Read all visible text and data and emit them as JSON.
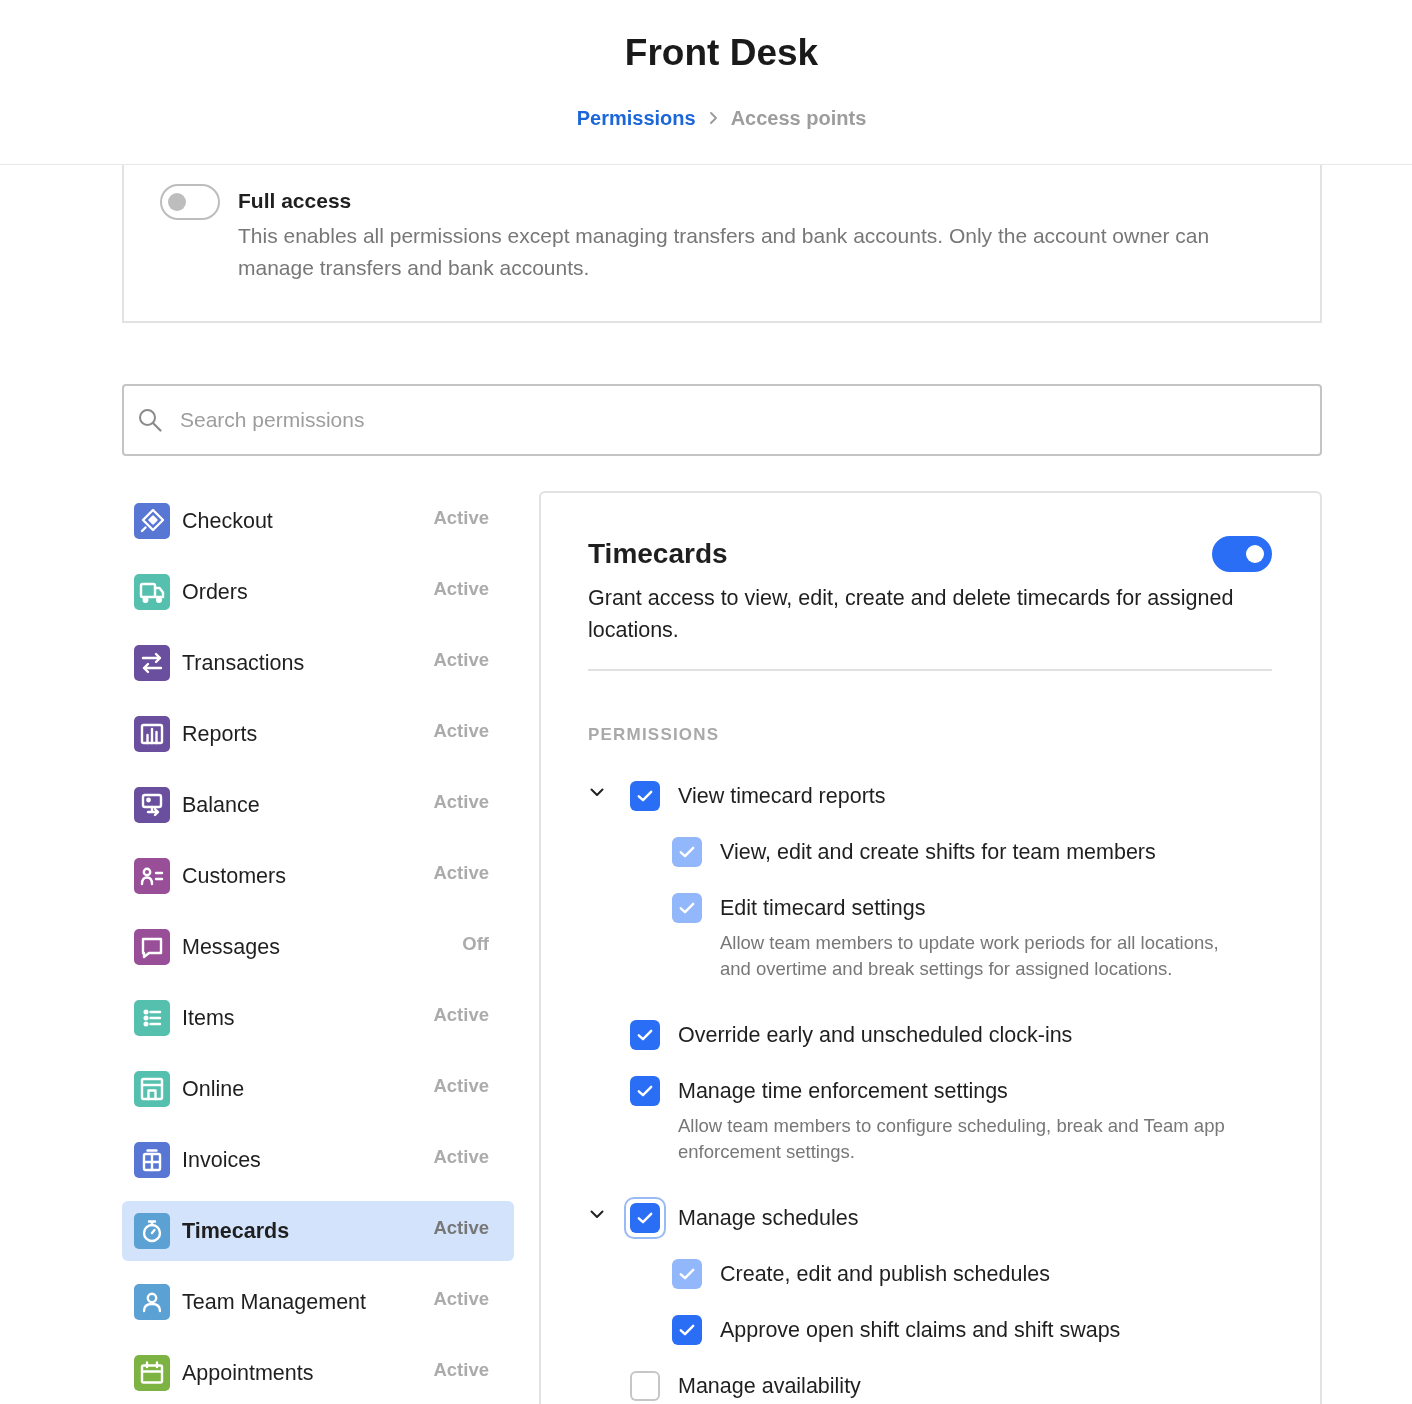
{
  "header": {
    "title": "Front Desk",
    "breadcrumb": [
      {
        "label": "Permissions",
        "kind": "link"
      },
      {
        "label": "Access points",
        "kind": "current"
      }
    ]
  },
  "full_access": {
    "label": "Full access",
    "on": false,
    "description": "This enables all permissions except managing transfers and bank accounts. Only the account owner can manage transfers and bank accounts."
  },
  "search": {
    "placeholder": "Search permissions"
  },
  "sidebar": {
    "items": [
      {
        "name": "Checkout",
        "status": "Active",
        "selected": false,
        "color": "#5877d4"
      },
      {
        "name": "Orders",
        "status": "Active",
        "selected": false,
        "color": "#56c0ae"
      },
      {
        "name": "Transactions",
        "status": "Active",
        "selected": false,
        "color": "#6a4f9e"
      },
      {
        "name": "Reports",
        "status": "Active",
        "selected": false,
        "color": "#6a4f9e"
      },
      {
        "name": "Balance",
        "status": "Active",
        "selected": false,
        "color": "#6a4f9e"
      },
      {
        "name": "Customers",
        "status": "Active",
        "selected": false,
        "color": "#984f98"
      },
      {
        "name": "Messages",
        "status": "Off",
        "selected": false,
        "color": "#984f98"
      },
      {
        "name": "Items",
        "status": "Active",
        "selected": false,
        "color": "#56c0ae"
      },
      {
        "name": "Online",
        "status": "Active",
        "selected": false,
        "color": "#56c0ae"
      },
      {
        "name": "Invoices",
        "status": "Active",
        "selected": false,
        "color": "#5877d4"
      },
      {
        "name": "Timecards",
        "status": "Active",
        "selected": true,
        "color": "#5ba1d4"
      },
      {
        "name": "Team Management",
        "status": "Active",
        "selected": false,
        "color": "#5ba1d4"
      },
      {
        "name": "Appointments",
        "status": "Active",
        "selected": false,
        "color": "#7cb342"
      }
    ]
  },
  "detail": {
    "title": "Timecards",
    "on": true,
    "description": "Grant access to view, edit, create and delete timecards for assigned locations.",
    "section_label": "PERMISSIONS",
    "permissions": [
      {
        "label": "View timecard reports",
        "checked": true,
        "disabled": false,
        "focused": false,
        "expanded": true,
        "children": [
          {
            "label": "View, edit and create shifts for team members",
            "checked": true,
            "disabled": true,
            "focused": false
          },
          {
            "label": "Edit timecard settings",
            "checked": true,
            "disabled": true,
            "focused": false,
            "description": "Allow team members to update work periods for all locations, and overtime and break settings for assigned locations."
          }
        ]
      },
      {
        "label": "Override early and unscheduled clock-ins",
        "checked": true,
        "disabled": false,
        "focused": false
      },
      {
        "label": "Manage time enforcement settings",
        "checked": true,
        "disabled": false,
        "focused": false,
        "description": "Allow team members to configure scheduling, break and Team app enforcement settings."
      },
      {
        "label": "Manage schedules",
        "checked": true,
        "disabled": false,
        "focused": true,
        "expanded": true,
        "children": [
          {
            "label": "Create, edit and publish schedules",
            "checked": true,
            "disabled": true,
            "focused": false
          },
          {
            "label": "Approve open shift claims and shift swaps",
            "checked": true,
            "disabled": false,
            "focused": false
          }
        ]
      },
      {
        "label": "Manage availability",
        "checked": false,
        "disabled": false,
        "focused": false
      }
    ]
  }
}
